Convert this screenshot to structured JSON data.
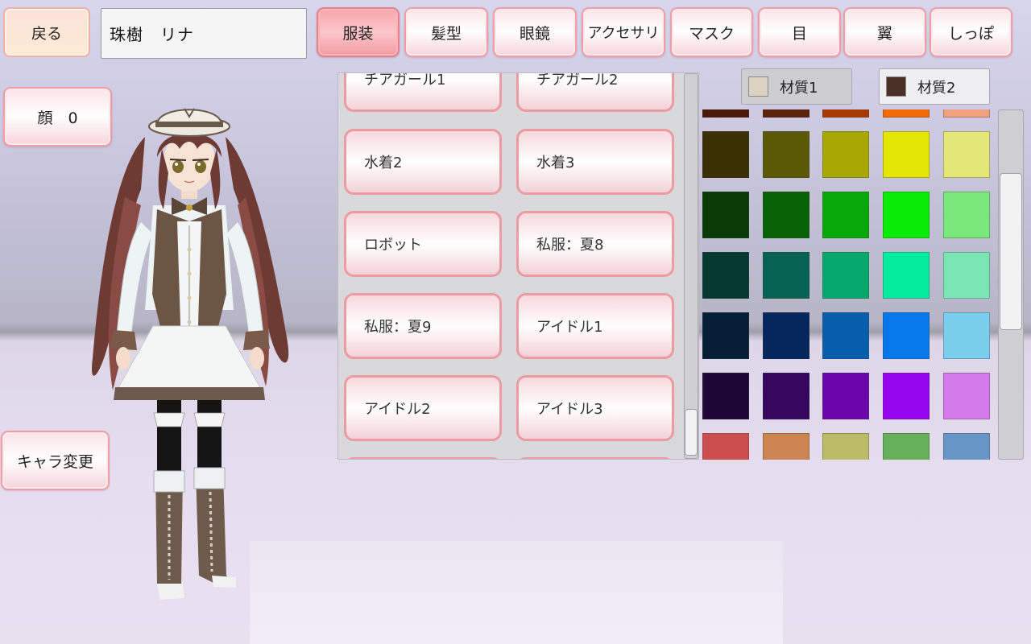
{
  "top_bar": {
    "back_label": "戻る",
    "character_name": "珠樹　リナ",
    "tabs": [
      {
        "label": "服装",
        "active": true
      },
      {
        "label": "髪型",
        "active": false
      },
      {
        "label": "眼鏡",
        "active": false
      },
      {
        "label": "アクセサリ",
        "active": false
      },
      {
        "label": "マスク",
        "active": false
      },
      {
        "label": "目",
        "active": false
      },
      {
        "label": "翼",
        "active": false
      },
      {
        "label": "しっぽ",
        "active": false
      }
    ]
  },
  "left_buttons": {
    "face_label": "顔　0",
    "change_character_label": "キャラ変更"
  },
  "outfit_list": {
    "items": [
      [
        "チアガール1",
        "チアガール2"
      ],
      [
        "水着2",
        "水着3"
      ],
      [
        "ロボット",
        "私服：夏8"
      ],
      [
        "私服：夏9",
        "アイドル1"
      ],
      [
        "アイドル2",
        "アイドル3"
      ],
      [
        "",
        ""
      ]
    ]
  },
  "materials": {
    "tab1": {
      "label": "材質1",
      "color": "#dcd3c2"
    },
    "tab2": {
      "label": "材質2",
      "color": "#4a3128"
    }
  },
  "palette": {
    "rows": [
      [
        "#4a1a08",
        "#5a2408",
        "#a83a06",
        "#f06a06",
        "#f0a07a"
      ],
      [
        "#3a3004",
        "#5a5a06",
        "#a8a804",
        "#e2e602",
        "#e4e678"
      ],
      [
        "#0a3a06",
        "#086206",
        "#08a808",
        "#08ec06",
        "#7ae87a"
      ],
      [
        "#063a30",
        "#066252",
        "#06a86e",
        "#06ec9e",
        "#7ae6b6"
      ],
      [
        "#061e36",
        "#06265e",
        "#065eac",
        "#0678ec",
        "#7ad0ec"
      ],
      [
        "#1e0636",
        "#36065e",
        "#6a06ac",
        "#9606ec",
        "#d47aea"
      ],
      [
        "#cc4e4e",
        "#cc8450",
        "#bcbc68",
        "#66b05c",
        "#6896c6"
      ]
    ]
  }
}
